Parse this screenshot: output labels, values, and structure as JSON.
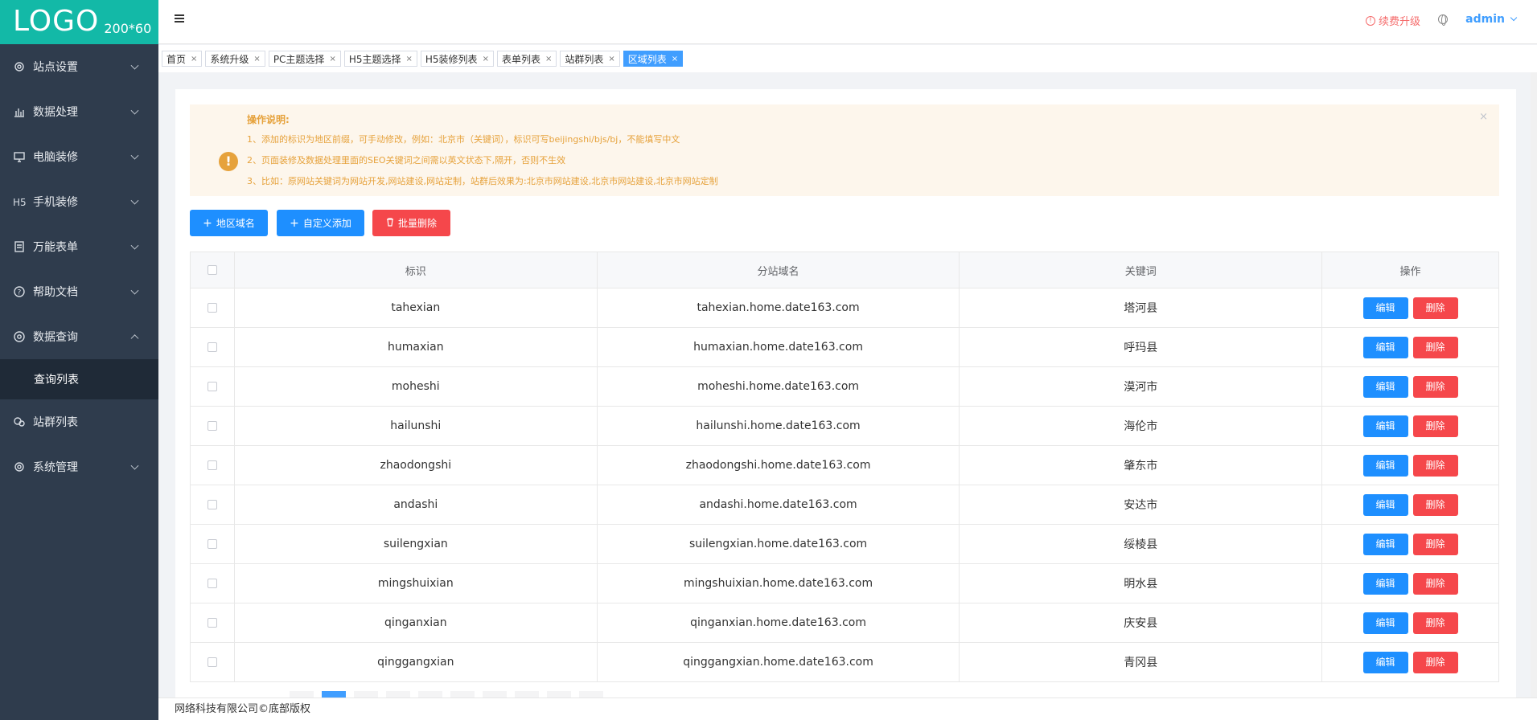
{
  "logo": {
    "text": "LOGO",
    "size": "200*60"
  },
  "sidebar": {
    "items": [
      {
        "label": "站点设置",
        "icon": "gear-icon"
      },
      {
        "label": "数据处理",
        "icon": "bar-chart-icon"
      },
      {
        "label": "电脑装修",
        "icon": "monitor-icon"
      },
      {
        "label": "手机装修",
        "icon": "h5-icon"
      },
      {
        "label": "万能表单",
        "icon": "form-icon"
      },
      {
        "label": "帮助文档",
        "icon": "help-icon"
      },
      {
        "label": "数据查询",
        "icon": "search-icon",
        "expanded": true
      },
      {
        "label": "站群列表",
        "icon": "sites-icon"
      },
      {
        "label": "系统管理",
        "icon": "gear-icon"
      }
    ],
    "sub_item": "查询列表"
  },
  "header": {
    "renew": "续费升级",
    "user": "admin"
  },
  "tabs": [
    {
      "label": "首页",
      "active": false
    },
    {
      "label": "系统升级",
      "active": false
    },
    {
      "label": "PC主题选择",
      "active": false
    },
    {
      "label": "H5主题选择",
      "active": false
    },
    {
      "label": "H5装修列表",
      "active": false
    },
    {
      "label": "表单列表",
      "active": false
    },
    {
      "label": "站群列表",
      "active": false
    },
    {
      "label": "区域列表",
      "active": true
    }
  ],
  "notice": {
    "title": "操作说明:",
    "lines": [
      "1、添加的标识为地区前缀，可手动修改，例如：北京市（关键词），标识可写beijingshi/bjs/bj，不能填写中文",
      "2、页面装修及数据处理里面的SEO关键词之间需以英文状态下,隔开，否则不生效",
      "3、比如：原网站关键词为网站开发,网站建设,网站定制，站群后效果为:北京市网站建设,北京市网站建设,北京市网站定制"
    ]
  },
  "buttons": {
    "region": "地区域名",
    "custom": "自定义添加",
    "batch_delete": "批量删除"
  },
  "table": {
    "headers": [
      "标识",
      "分站域名",
      "关键词",
      "操作"
    ],
    "edit_label": "编辑",
    "delete_label": "删除",
    "rows": [
      {
        "id": "tahexian",
        "domain": "tahexian.home.date163.com",
        "keyword": "塔河县"
      },
      {
        "id": "humaxian",
        "domain": "humaxian.home.date163.com",
        "keyword": "呼玛县"
      },
      {
        "id": "moheshi",
        "domain": "moheshi.home.date163.com",
        "keyword": "漠河市"
      },
      {
        "id": "hailunshi",
        "domain": "hailunshi.home.date163.com",
        "keyword": "海伦市"
      },
      {
        "id": "zhaodongshi",
        "domain": "zhaodongshi.home.date163.com",
        "keyword": "肇东市"
      },
      {
        "id": "andashi",
        "domain": "andashi.home.date163.com",
        "keyword": "安达市"
      },
      {
        "id": "suilengxian",
        "domain": "suilengxian.home.date163.com",
        "keyword": "绥棱县"
      },
      {
        "id": "mingshuixian",
        "domain": "mingshuixian.home.date163.com",
        "keyword": "明水县"
      },
      {
        "id": "qinganxian",
        "domain": "qinganxian.home.date163.com",
        "keyword": "庆安县"
      },
      {
        "id": "qinggangxian",
        "domain": "qinggangxian.home.date163.com",
        "keyword": "青冈县"
      }
    ]
  },
  "footer": "网络科技有限公司©底部版权"
}
